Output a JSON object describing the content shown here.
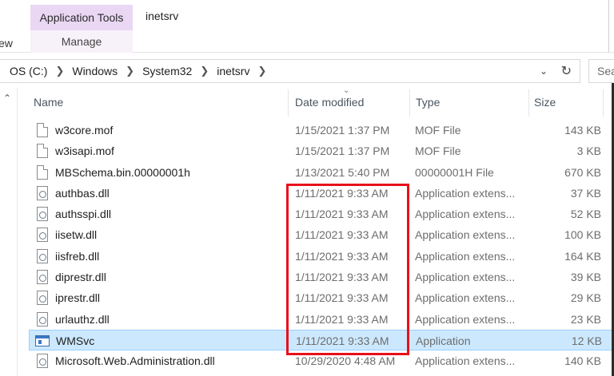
{
  "ribbon": {
    "view_tab": "ew",
    "context_group": "Application Tools",
    "context_tab": "Manage",
    "title": "inetsrv"
  },
  "address": {
    "crumbs": [
      "OS (C:)",
      "Windows",
      "System32",
      "inetsrv"
    ],
    "search_placeholder": "Sea"
  },
  "columns": {
    "name": "Name",
    "date": "Date modified",
    "type": "Type",
    "size": "Size"
  },
  "files": [
    {
      "name": "w3core.mof",
      "date": "1/15/2021 1:37 PM",
      "type": "MOF File",
      "size": "143 KB",
      "icon": "file"
    },
    {
      "name": "w3isapi.mof",
      "date": "1/15/2021 1:37 PM",
      "type": "MOF File",
      "size": "3 KB",
      "icon": "file"
    },
    {
      "name": "MBSchema.bin.00000001h",
      "date": "1/13/2021 5:40 PM",
      "type": "00000001H File",
      "size": "670 KB",
      "icon": "file"
    },
    {
      "name": "authbas.dll",
      "date": "1/11/2021 9:33 AM",
      "type": "Application extens...",
      "size": "37 KB",
      "icon": "dll"
    },
    {
      "name": "authsspi.dll",
      "date": "1/11/2021 9:33 AM",
      "type": "Application extens...",
      "size": "52 KB",
      "icon": "dll"
    },
    {
      "name": "iisetw.dll",
      "date": "1/11/2021 9:33 AM",
      "type": "Application extens...",
      "size": "100 KB",
      "icon": "dll"
    },
    {
      "name": "iisfreb.dll",
      "date": "1/11/2021 9:33 AM",
      "type": "Application extens...",
      "size": "164 KB",
      "icon": "dll"
    },
    {
      "name": "diprestr.dll",
      "date": "1/11/2021 9:33 AM",
      "type": "Application extens...",
      "size": "39 KB",
      "icon": "dll"
    },
    {
      "name": "iprestr.dll",
      "date": "1/11/2021 9:33 AM",
      "type": "Application extens...",
      "size": "29 KB",
      "icon": "dll"
    },
    {
      "name": "urlauthz.dll",
      "date": "1/11/2021 9:33 AM",
      "type": "Application extens...",
      "size": "23 KB",
      "icon": "dll"
    },
    {
      "name": "WMSvc",
      "date": "1/11/2021 9:33 AM",
      "type": "Application",
      "size": "12 KB",
      "icon": "app",
      "selected": true
    },
    {
      "name": "Microsoft.Web.Administration.dll",
      "date": "10/29/2020 4:48 AM",
      "type": "Application extens...",
      "size": "140 KB",
      "icon": "dll"
    }
  ],
  "colors": {
    "highlight": "#e8101a",
    "selection": "#cce8ff",
    "context_header": "#ead7f3"
  }
}
